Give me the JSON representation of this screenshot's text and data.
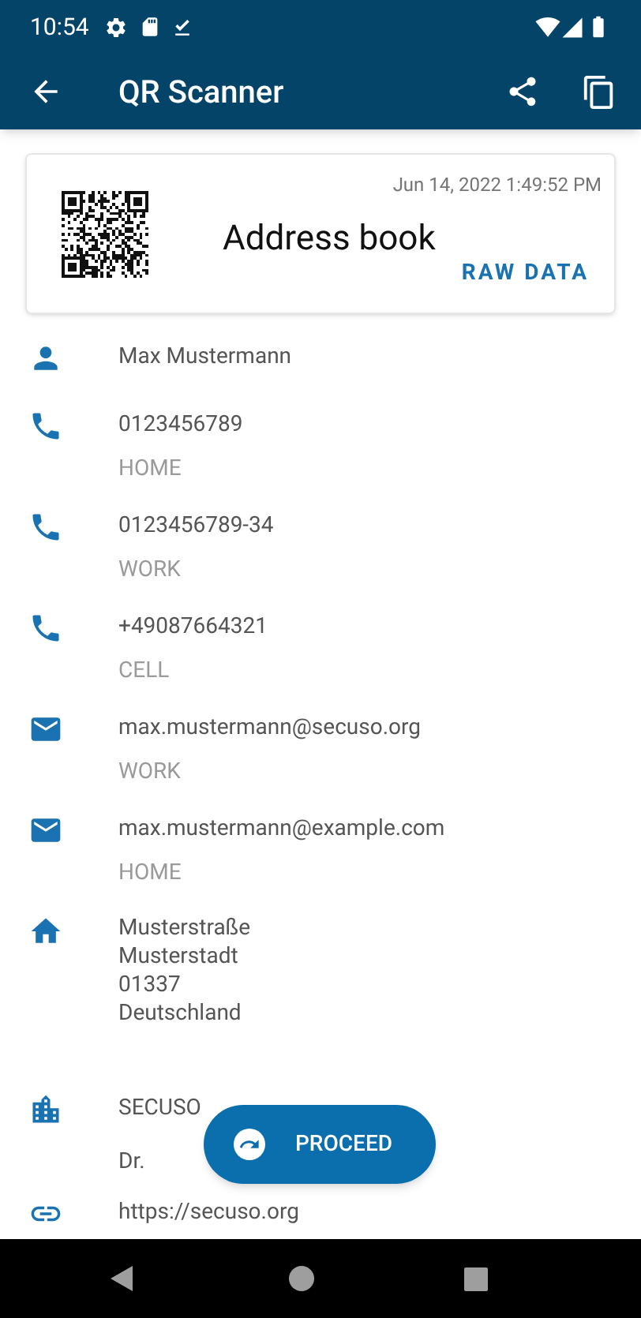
{
  "status_bar": {
    "time": "10:54"
  },
  "app_bar": {
    "title": "QR Scanner"
  },
  "card": {
    "timestamp": "Jun 14, 2022 1:49:52 PM",
    "title": "Address book",
    "action": "RAW DATA"
  },
  "entries": [
    {
      "kind": "person",
      "lines": [
        "Max Mustermann"
      ]
    },
    {
      "kind": "phone",
      "lines": [
        "0123456789"
      ],
      "label": "HOME"
    },
    {
      "kind": "phone",
      "lines": [
        "0123456789-34"
      ],
      "label": "WORK"
    },
    {
      "kind": "phone",
      "lines": [
        "+49087664321"
      ],
      "label": "CELL"
    },
    {
      "kind": "email",
      "lines": [
        "max.mustermann@secuso.org"
      ],
      "label": "WORK"
    },
    {
      "kind": "email",
      "lines": [
        "max.mustermann@example.com"
      ],
      "label": "HOME"
    },
    {
      "kind": "address",
      "lines": [
        "Musterstraße",
        "Musterstadt",
        "01337",
        "Deutschland"
      ]
    },
    {
      "kind": "company",
      "lines": [
        "SECUSO"
      ],
      "subtitle": "Dr."
    },
    {
      "kind": "url",
      "lines": [
        "https://secuso.org"
      ]
    }
  ],
  "fab": {
    "label": "PROCEED"
  }
}
